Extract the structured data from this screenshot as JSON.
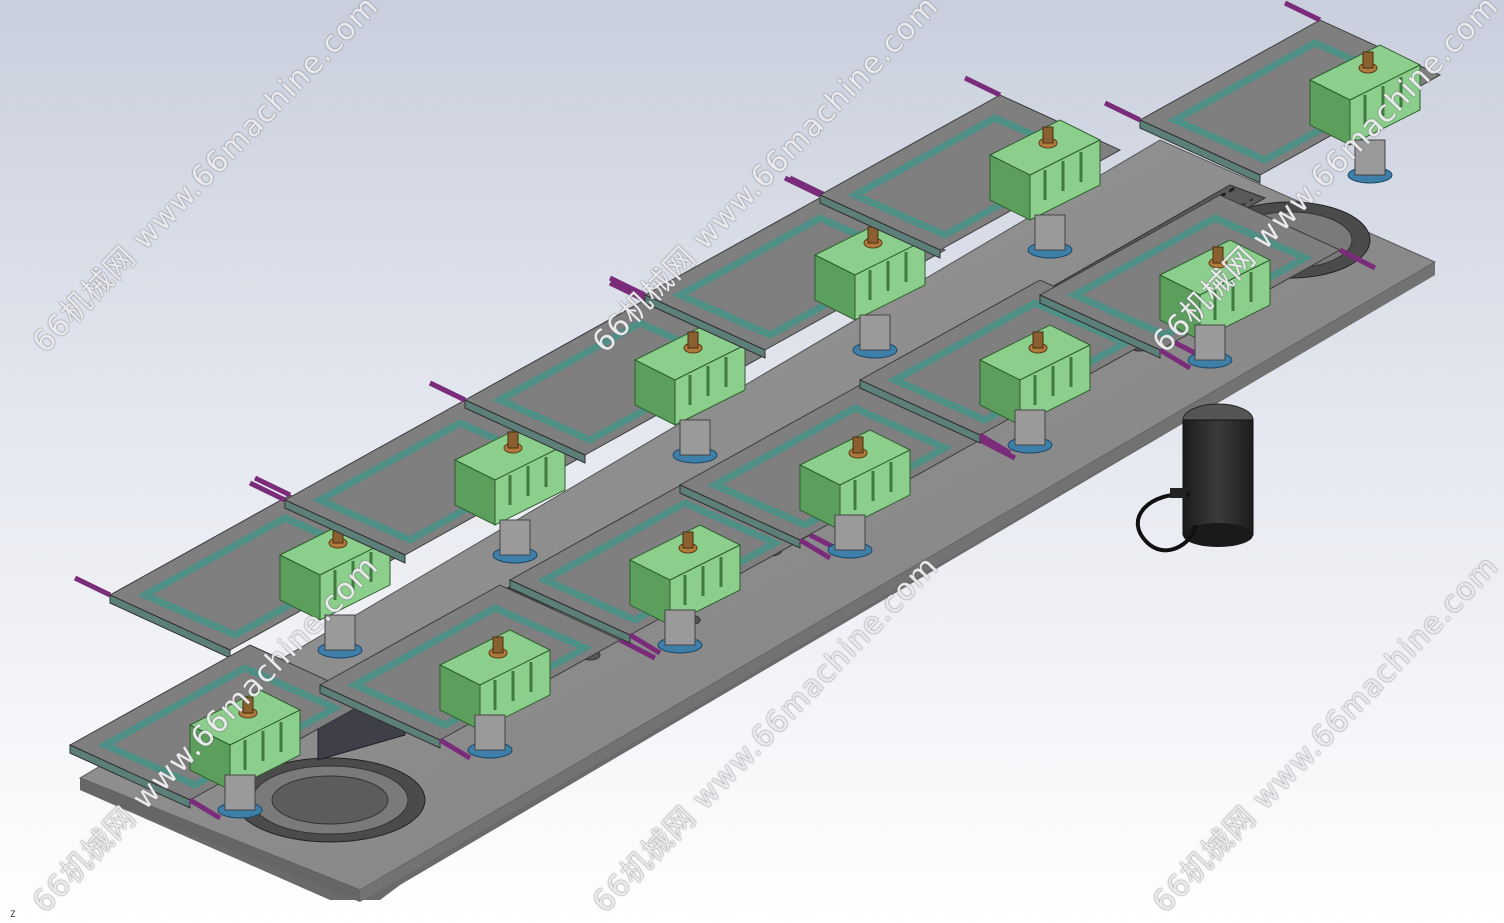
{
  "watermark": {
    "text": "66机械网 www.66machine.com"
  },
  "axis_indicator": {
    "label": "Z"
  },
  "colors": {
    "background_top": "#c9cfdd",
    "base_plate": "#8a8a8a",
    "base_plate_edge": "#5e5e5e",
    "fixture_green": "#8ccf8c",
    "fixture_green_dark": "#5c9e5c",
    "fixture_frame_teal": "#4e8f86",
    "purple_tab": "#7a2c7a",
    "chain_dark": "#3a3a3a",
    "motor_black": "#262626",
    "brass_knob": "#b07a3c",
    "blue_roller": "#3d7fa8"
  },
  "icons": {
    "fixture": "fixture-module-icon",
    "motor": "servo-motor-icon",
    "gear": "ring-gear-icon"
  }
}
